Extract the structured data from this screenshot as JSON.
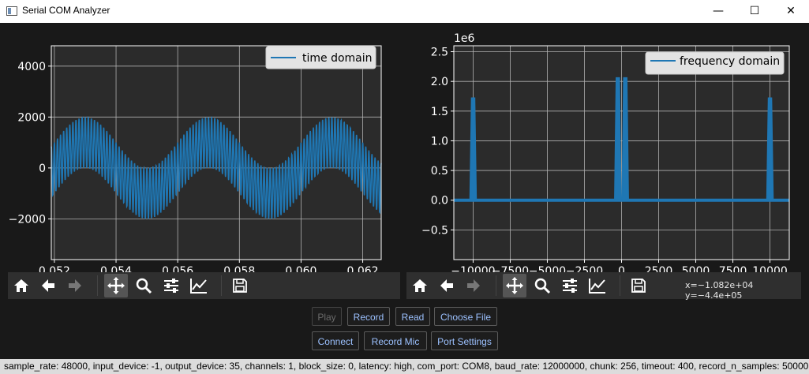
{
  "window": {
    "title": "Serial COM Analyzer",
    "minimize_glyph": "—",
    "maximize_glyph": "☐",
    "close_glyph": "✕",
    "icon": "app-window-icon"
  },
  "toolbar_icons": [
    "home-icon",
    "back-arrow-icon",
    "forward-arrow-icon",
    "pan-icon",
    "zoom-icon",
    "configure-subplots-icon",
    "edit-axis-icon",
    "save-icon"
  ],
  "coordinate_readout": "x=−1.082e+04 y=−4.4e+05",
  "buttons": {
    "play": "Play",
    "record": "Record",
    "read": "Read",
    "choose_file": "Choose File",
    "connect": "Connect",
    "record_mic": "Record Mic",
    "port_settings": "Port Settings"
  },
  "status_text": "sample_rate: 48000, input_device: -1, output_device: 35, channels: 1, block_size: 0, latency: high, com_port: COM8, baud_rate: 12000000, chunk: 256, timeout: 400, record_n_samples: 50000",
  "colors": {
    "line": "#1f77b4",
    "plot_bg": "#2b2b2b",
    "figure_bg": "#191919",
    "grid": "#b0b0b0",
    "accent_text": "#9cc1ff"
  },
  "chart_data": [
    {
      "type": "line",
      "legend": "time domain",
      "legend_position": "top-right",
      "grid": true,
      "x_ticks": [
        "0.052",
        "0.054",
        "0.056",
        "0.058",
        "0.060",
        "0.062"
      ],
      "x_tick_values": [
        0.052,
        0.054,
        0.056,
        0.058,
        0.06,
        0.062
      ],
      "y_ticks": [
        "4000",
        "2000",
        "0",
        "−2000"
      ],
      "y_tick_values": [
        4000,
        2000,
        0,
        -2000
      ],
      "xlim": [
        0.0519,
        0.0626
      ],
      "ylim": [
        -3600,
        4800
      ],
      "signal": {
        "low_freq_hz": 250,
        "low_amplitude": 1000,
        "high_freq_hz": 10000,
        "high_amplitude": 1000,
        "phase_reference_x": 0.057
      }
    },
    {
      "type": "line",
      "legend": "frequency domain",
      "legend_position": "top-right",
      "grid": true,
      "scale_label": "1e6",
      "x_ticks": [
        "−10000",
        "−7500",
        "−5000",
        "−2500",
        "0",
        "2500",
        "5000",
        "7500",
        "10000"
      ],
      "x_tick_values": [
        -10000,
        -7500,
        -5000,
        -2500,
        0,
        2500,
        5000,
        7500,
        10000
      ],
      "y_ticks": [
        "2.5",
        "2.0",
        "1.5",
        "1.0",
        "0.5",
        "0.0",
        "−0.5"
      ],
      "y_tick_values": [
        2.5,
        2.0,
        1.5,
        1.0,
        0.5,
        0.0,
        -0.5
      ],
      "xlim": [
        -11300,
        11300
      ],
      "ylim": [
        -1.0,
        2.6
      ],
      "baseline": 0.0,
      "peaks": [
        {
          "x": -10000,
          "y": 1.72
        },
        {
          "x": -250,
          "y": 2.06
        },
        {
          "x": 250,
          "y": 2.06
        },
        {
          "x": 10000,
          "y": 1.72
        }
      ]
    }
  ]
}
